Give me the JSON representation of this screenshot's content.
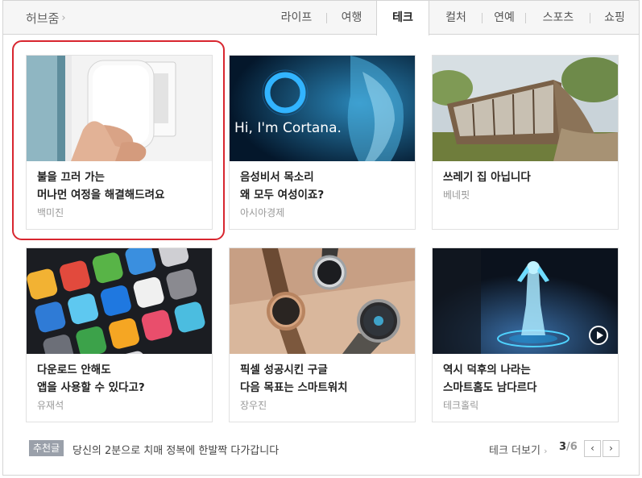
{
  "header": {
    "brand": "허브줌",
    "tabs": [
      {
        "label": "라이프"
      },
      {
        "label": "여행"
      },
      {
        "label": "테크",
        "active": true
      },
      {
        "label": "컬처"
      },
      {
        "label": "연예"
      },
      {
        "label": "스포츠"
      },
      {
        "label": "쇼핑"
      }
    ]
  },
  "cards": [
    {
      "title_lines": [
        "불을 끄러 가는",
        "머나먼 여정을 해결해드려요"
      ],
      "source": "백미진",
      "image": "light-switch-device-image"
    },
    {
      "title_lines": [
        "음성비서 목소리",
        "왜 모두 여성이죠?"
      ],
      "source": "아시아경제",
      "image": "cortana-image",
      "image_text": "Hi, I'm Cortana."
    },
    {
      "title_lines": [
        "쓰레기 집 아닙니다"
      ],
      "source": "베네핏",
      "image": "eco-house-image"
    },
    {
      "title_lines": [
        "다운로드 안해도",
        "앱을 사용할 수 있다고?"
      ],
      "source": "유재석",
      "image": "app-icons-image"
    },
    {
      "title_lines": [
        "픽셀 성공시킨 구글",
        "다음 목표는 스마트워치"
      ],
      "source": "장우진",
      "image": "smartwatch-image"
    },
    {
      "title_lines": [
        "역시 덕후의 나라는",
        "스마트홈도 남다르다"
      ],
      "source": "테크홀릭",
      "image": "hologram-image",
      "has_video": true
    }
  ],
  "footer": {
    "recommend_badge": "추천글",
    "recommend_text": "당신의 2분으로 치매 정복에 한발짝 다가갑니다",
    "more_label": "테크 더보기",
    "page_current": "3",
    "page_total": "6",
    "prev_label": "‹",
    "next_label": "›"
  },
  "colors": {
    "highlight": "#d8262f",
    "badge_bg": "#9aa0aa"
  }
}
